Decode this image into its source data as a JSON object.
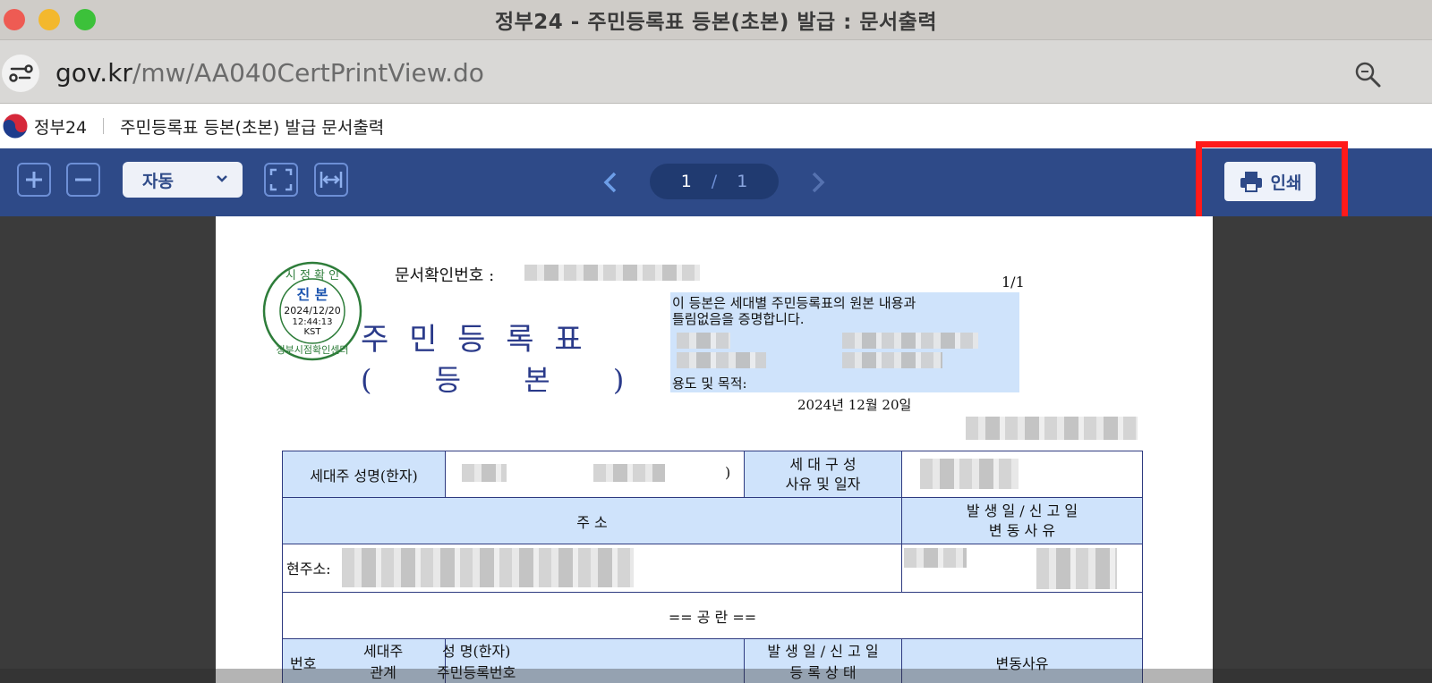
{
  "window": {
    "title": "정부24 - 주민등록표 등본(초본) 발급 : 문서출력"
  },
  "addressbar": {
    "domain": "gov.kr",
    "path": "/mw/AA040CertPrintView.do"
  },
  "site": {
    "brand": "정부24",
    "page_title": "주민등록표 등본(초본) 발급 문서출력"
  },
  "toolbar": {
    "zoom_value": "자동",
    "page_current": "1",
    "page_sep": "/",
    "page_total": "1",
    "print_label": "인쇄"
  },
  "document": {
    "stamp": {
      "top": "시 정 확 인",
      "main": "진 본",
      "date": "2024/12/20",
      "time": "12:44:13",
      "tz": "KST",
      "bottom": "정부시점확인센터"
    },
    "doc_no_label": "문서확인번호 :",
    "page_no": "1/1",
    "title_main": "주 민 등 록 표",
    "title_sub": "( 등 본 )",
    "cert_line1": "이 등본은 세대별 주민등록표의 원본 내용과",
    "cert_line2": "틀림없음을 증명합니다.",
    "purpose_label": "용도 및 목적:",
    "date": "2024년 12월 20일",
    "table": {
      "head_name_label": "세대주 성명(한자)",
      "name_close": ")",
      "composition_label_1": "세 대 구 성",
      "composition_label_2": "사유 및 일자",
      "address_header": "주                  소",
      "date_header_1": "발 생 일 / 신 고 일",
      "date_header_2": "변   동   사   유",
      "current_address_label": "현주소:",
      "blank_row": "==   공   란   ==",
      "col_no": "번호",
      "col_relation_1": "세대주",
      "col_relation_2": "관계",
      "col_name_1": "성  명(한자)",
      "col_name_2": "주민등록번호",
      "col_date_1": "발 생 일  /  신 고 일",
      "col_date_2": "등 록 상 태",
      "col_reason": "변동사유"
    }
  },
  "colors": {
    "toolbar_bg": "#2e4a88",
    "highlight": "#ff1a1a",
    "cell_blue": "#cfe3fb"
  }
}
